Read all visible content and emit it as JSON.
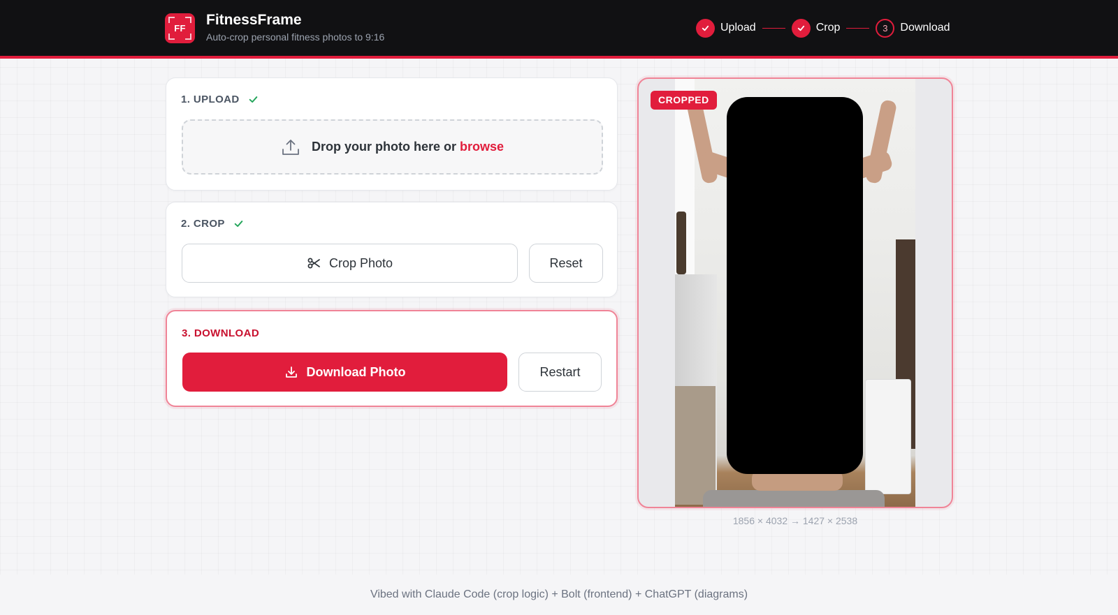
{
  "header": {
    "logo_text": "FF",
    "title": "FitnessFrame",
    "subtitle": "Auto-crop personal fitness photos to 9:16"
  },
  "steps": [
    {
      "label": "Upload",
      "state": "done"
    },
    {
      "label": "Crop",
      "state": "done"
    },
    {
      "label": "Download",
      "state": "current",
      "number": "3"
    }
  ],
  "upload": {
    "heading": "1. UPLOAD",
    "drop_text": "Drop your photo here or",
    "browse_link": "browse"
  },
  "crop": {
    "heading": "2. CROP",
    "crop_button": "Crop Photo",
    "reset_button": "Reset"
  },
  "download": {
    "heading": "3. DOWNLOAD",
    "download_button": "Download Photo",
    "restart_button": "Restart"
  },
  "preview": {
    "badge": "CROPPED",
    "dimensions": "1856 × 4032 → 1427 × 2538"
  },
  "footer": {
    "text": "Vibed with Claude Code (crop logic) + Bolt (frontend) + ChatGPT (diagrams)"
  },
  "colors": {
    "accent": "#e11d3c",
    "header_bg": "#111113",
    "success": "#22a55a"
  }
}
